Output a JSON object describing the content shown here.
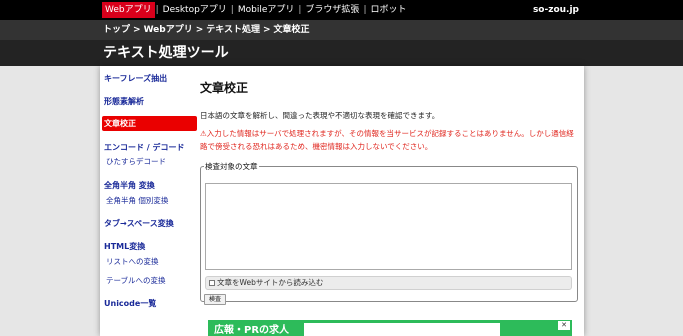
{
  "topnav": {
    "items": [
      "Webアプリ",
      "Desktopアプリ",
      "Mobileアプリ",
      "ブラウザ拡張",
      "ロボット"
    ],
    "site": "so-zou.jp"
  },
  "breadcrumb": [
    "トップ",
    "Webアプリ",
    "テキスト処理",
    "文章校正"
  ],
  "page_title": "テキスト処理ツール",
  "sidebar": {
    "items": [
      {
        "label": "キーフレーズ抽出",
        "type": "main"
      },
      {
        "label": "形態素解析",
        "type": "main"
      },
      {
        "label": "文章校正",
        "type": "active"
      },
      {
        "label": "エンコード / デコード",
        "type": "main"
      },
      {
        "label": "ひたすらデコード",
        "type": "sub"
      },
      {
        "label": "全角半角 変換",
        "type": "main"
      },
      {
        "label": "全角半角 個別変換",
        "type": "sub"
      },
      {
        "label": "タブ→スペース変換",
        "type": "main"
      },
      {
        "label": "HTML変換",
        "type": "main"
      },
      {
        "label": "リストへの変換",
        "type": "sub"
      },
      {
        "label": "テーブルへの変換",
        "type": "sub"
      },
      {
        "label": "Unicode一覧",
        "type": "main"
      }
    ]
  },
  "main": {
    "heading": "文章校正",
    "description": "日本語の文章を解析し、間違った表現や不適切な表現を確認できます。",
    "warning": "⚠入力した情報はサーバで処理されますが、その情報を当サービスが記録することはありません。しかし通信経路で傍受される恐れはあるため、機密情報は入力しないでください。",
    "fieldset_legend": "検査対象の文章",
    "textarea_value": "",
    "load_label": "文章をWebサイトから読み込む",
    "check_button": "検査"
  },
  "ad": {
    "label": "広報・PRの求人"
  },
  "colors": {
    "active_nav": "#d9001b",
    "sidebar_active": "#ea0000",
    "link": "#1a2a99",
    "warning": "#e0261e",
    "ad_bg": "#2dbb5a"
  }
}
